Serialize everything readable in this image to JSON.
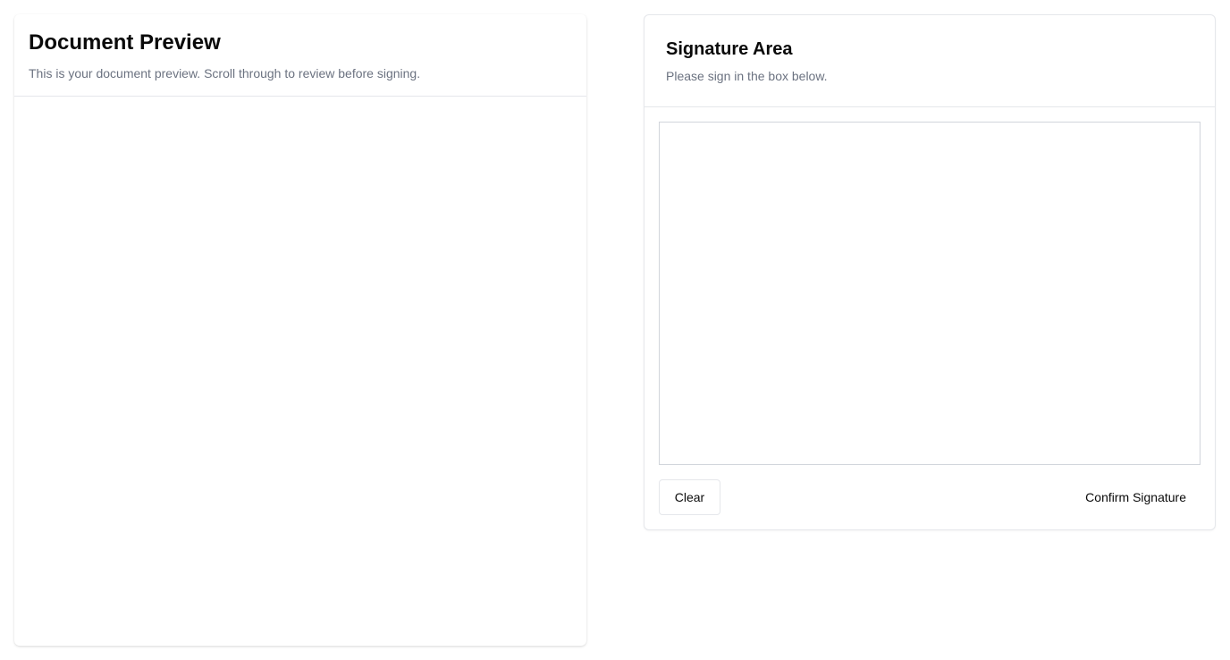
{
  "document_preview": {
    "title": "Document Preview",
    "description": "This is your document preview. Scroll through to review before signing."
  },
  "signature": {
    "title": "Signature Area",
    "description": "Please sign in the box below.",
    "clear_label": "Clear",
    "confirm_label": "Confirm Signature"
  },
  "colors": {
    "text_primary": "#0a0a0a",
    "text_muted": "#6b7280",
    "border": "#e5e7eb",
    "canvas_border": "#d1d5db",
    "background": "#ffffff"
  }
}
